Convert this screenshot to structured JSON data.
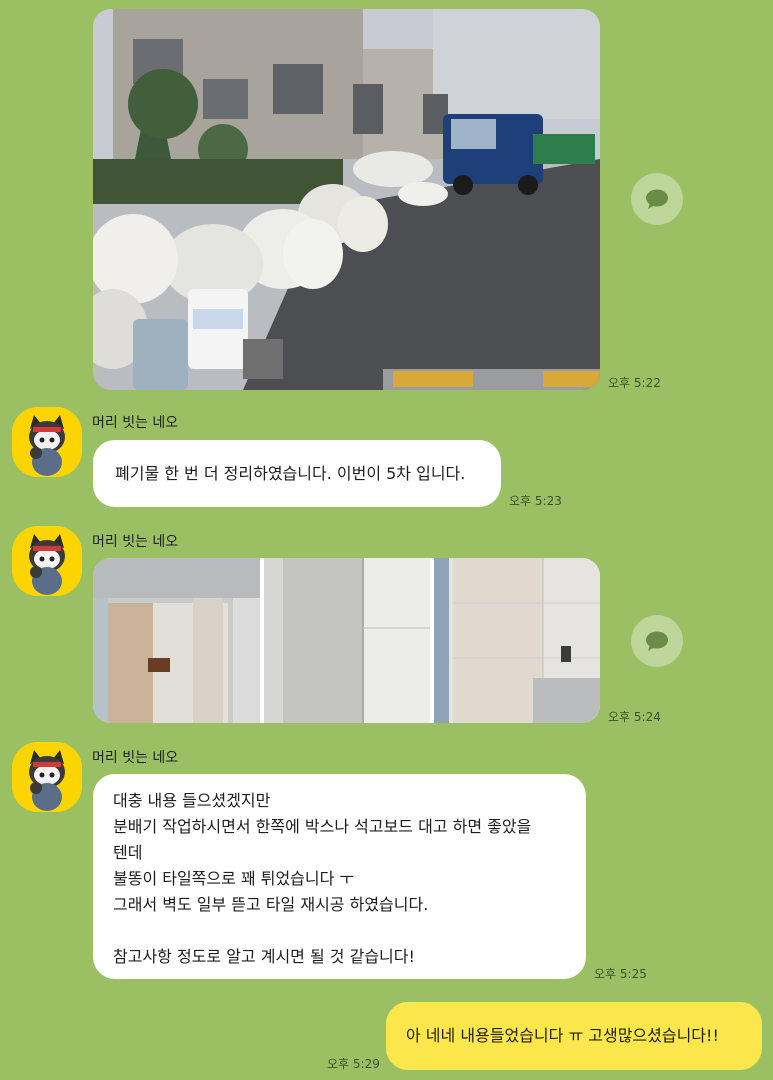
{
  "messages": {
    "photo1": {
      "time": "오후 5:22"
    },
    "msg1": {
      "sender": "머리 빗는 네오",
      "text": "폐기물 한 번 더 정리하였습니다. 이번이 5차 입니다.",
      "time": "오후 5:23"
    },
    "photo2": {
      "sender": "머리 빗는 네오",
      "time": "오후 5:24"
    },
    "msg2": {
      "sender": "머리 빗는 네오",
      "lines": [
        "대충 내용 들으셨겠지만",
        "분배기 작업하시면서 한쪽에 박스나 석고보드 대고 하면 좋았을",
        "텐데",
        "불똥이 타일쪽으로 꽤 튀었습니다 ㅜ",
        "그래서 벽도 일부 뜯고 타일 재시공 하였습니다.",
        "",
        "참고사항 정도로 알고 계시면 될 것 같습니다!"
      ],
      "time": "오후 5:25"
    },
    "reply": {
      "text": "아 네네 내용들었습니다 ㅠ 고생많으셨습니다!!",
      "time": "오후 5:29"
    }
  },
  "colors": {
    "background": "#9bc063",
    "my_bubble": "#fbe74c",
    "other_bubble": "#ffffff",
    "avatar_bg": "#fcd500"
  },
  "icons": {
    "share": "share-speech-bubble-icon",
    "avatar": "neo-cat-profile-icon"
  }
}
